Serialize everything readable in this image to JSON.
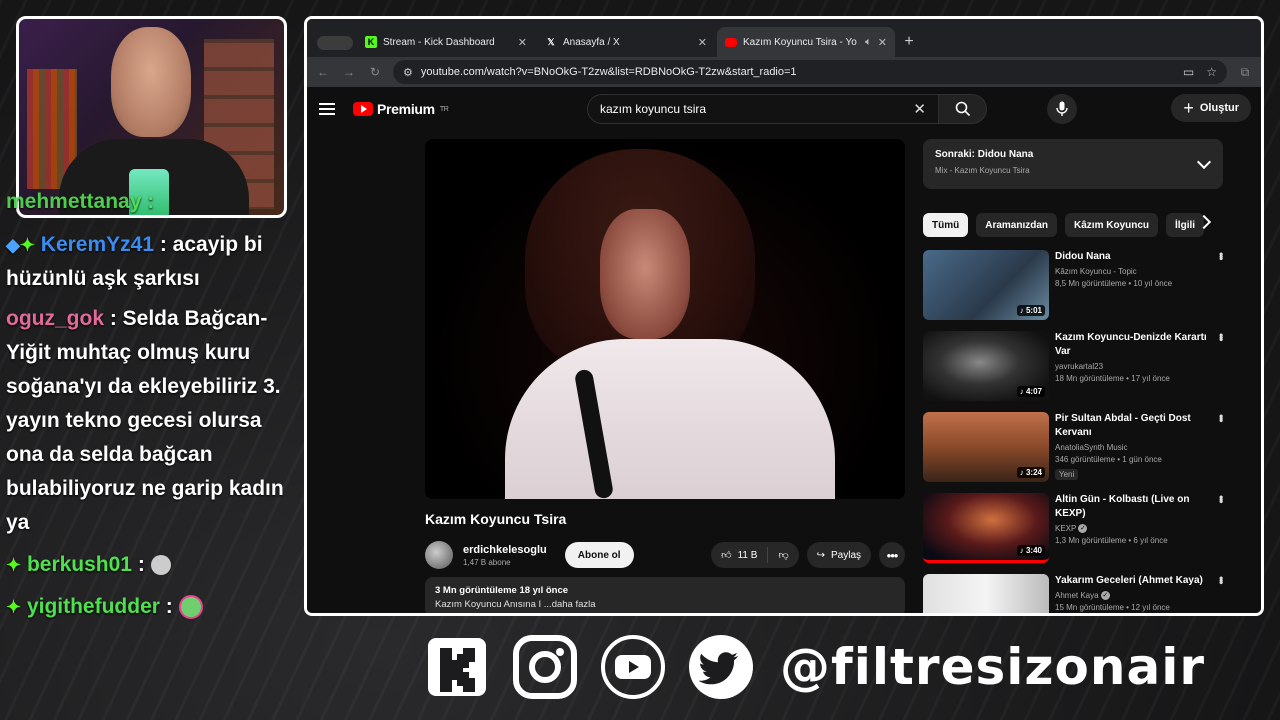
{
  "chat": {
    "partial_top": "mehmettanay :",
    "messages": [
      {
        "user": "KeremYz41",
        "text": " : acayip bi hüzünlü aşk şarkısı"
      },
      {
        "user": "oguz_gok",
        "text": " : Selda Bağcan-Yiğit muhtaç olmuş kuru soğana'yı da ekleyebiliriz 3. yayın tekno gecesi olursa ona da selda bağcan bulabiliyoruz ne garip kadın ya"
      },
      {
        "user": "berkush01",
        "text": " :"
      },
      {
        "user": "yigithefudder",
        "text": " :"
      }
    ]
  },
  "browser": {
    "tabs": [
      {
        "title": "Stream - Kick Dashboard",
        "icon": "kick-icon",
        "color": "#53fc18"
      },
      {
        "title": "Anasayfa / X",
        "icon": "x-icon",
        "color": "#ffffff"
      },
      {
        "title": "Kazım Koyuncu Tsira - Yo",
        "icon": "youtube-icon",
        "color": "#ff0000"
      }
    ],
    "url": "youtube.com/watch?v=BNoOkG-T2zw&list=RDBNoOkG-T2zw&start_radio=1"
  },
  "youtube": {
    "logo": "Premium",
    "logo_region": "TR",
    "search_value": "kazım koyuncu tsira",
    "create_label": "Oluştur",
    "video_title": "Kazım Koyuncu Tsira",
    "channel_name": "erdichkelesoglu",
    "subscribers": "1,47 B abone",
    "subscribe_label": "Abone ol",
    "likes": "11 B",
    "share_label": "Paylaş",
    "desc_stats": "3 Mn görüntüleme  18 yıl önce",
    "desc_text": "Kazım Koyuncu Anısına I ...daha fazla",
    "up_next_title": "Sonraki: Didou Nana",
    "up_next_sub": "Mix - Kazım Koyuncu Tsira",
    "chips": [
      "Tümü",
      "Aramanızdan",
      "Kâzım Koyuncu",
      "İlgili"
    ],
    "recommendations": [
      {
        "title": "Didou Nana",
        "channel": "Kâzım Koyuncu - Topic",
        "meta": "8,5 Mn görüntüleme • 10 yıl önce",
        "duration": "5:01",
        "verified": false,
        "new": ""
      },
      {
        "title": "Kazım Koyuncu-Denizde Karartı Var",
        "channel": "yavrukartal23",
        "meta": "18 Mn görüntüleme • 17 yıl önce",
        "duration": "4:07",
        "verified": false,
        "new": ""
      },
      {
        "title": "Pir Sultan Abdal - Geçti Dost Kervanı",
        "channel": "AnatoliaSynth Music",
        "meta": "346 görüntüleme • 1 gün önce",
        "duration": "3:24",
        "verified": false,
        "new": "Yeni"
      },
      {
        "title": "Altin Gün - Kolbastı (Live on KEXP)",
        "channel": "KEXP",
        "meta": "1,3 Mn görüntüleme • 6 yıl önce",
        "duration": "3:40",
        "verified": true,
        "new": ""
      },
      {
        "title": "Yakarım Geceleri (Ahmet Kaya)",
        "channel": "Ahmet Kaya",
        "meta": "15 Mn görüntüleme • 12 yıl önce",
        "duration": "",
        "verified": true,
        "new": ""
      }
    ]
  },
  "social_handle": "@filtresizonair"
}
